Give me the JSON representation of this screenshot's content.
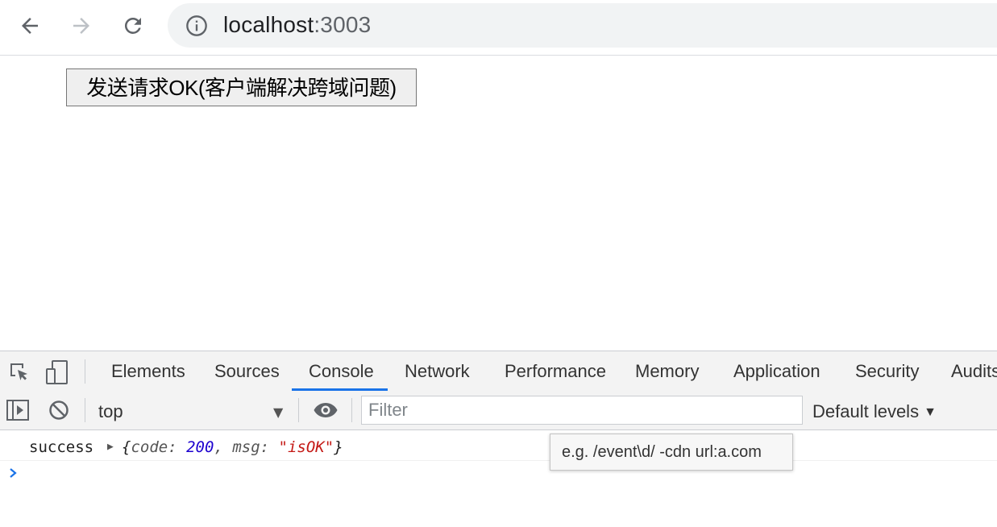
{
  "browser": {
    "url_host": "localhost",
    "url_port": ":3003",
    "back_label": "Back",
    "forward_label": "Forward",
    "reload_label": "Reload"
  },
  "page": {
    "button_label": "发送请求OK(客户端解决跨域问题)"
  },
  "devtools": {
    "tabs": [
      "Elements",
      "Sources",
      "Console",
      "Network",
      "Performance",
      "Memory",
      "Application",
      "Security",
      "Audits"
    ],
    "active_tab": "Console",
    "context": "top",
    "filter_placeholder": "Filter",
    "levels_label": "Default levels",
    "filter_tooltip": "e.g. /event\\d/ -cdn url:a.com",
    "console": {
      "log_label": "success",
      "object": {
        "open_brace": "{",
        "key1": "code",
        "val1": "200",
        "key2": "msg",
        "val2": "\"isOK\"",
        "close_brace": "}"
      }
    },
    "colors": {
      "accent": "#1a73e8",
      "number": "#1c00cf",
      "string": "#c41a16"
    }
  }
}
